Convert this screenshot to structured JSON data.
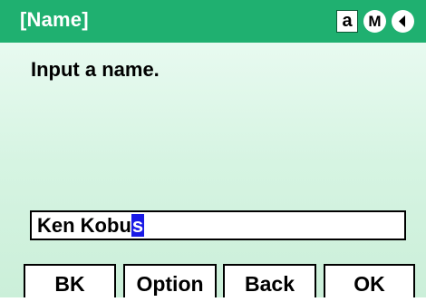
{
  "header": {
    "title": "[Name]",
    "mode_indicator": "a",
    "memory_indicator": "M",
    "arrow_icon": "triangle-left-icon"
  },
  "main": {
    "prompt": "Input a name."
  },
  "input": {
    "value_before_cursor": "Ken Kobu",
    "cursor_char": "s"
  },
  "softkeys": {
    "k1": "BK",
    "k2": "Option",
    "k3": "Back",
    "k4": "OK"
  },
  "colors": {
    "titlebar": "#1fb070",
    "background": "#d6f4e2",
    "cursor": "#1a1ae6"
  }
}
